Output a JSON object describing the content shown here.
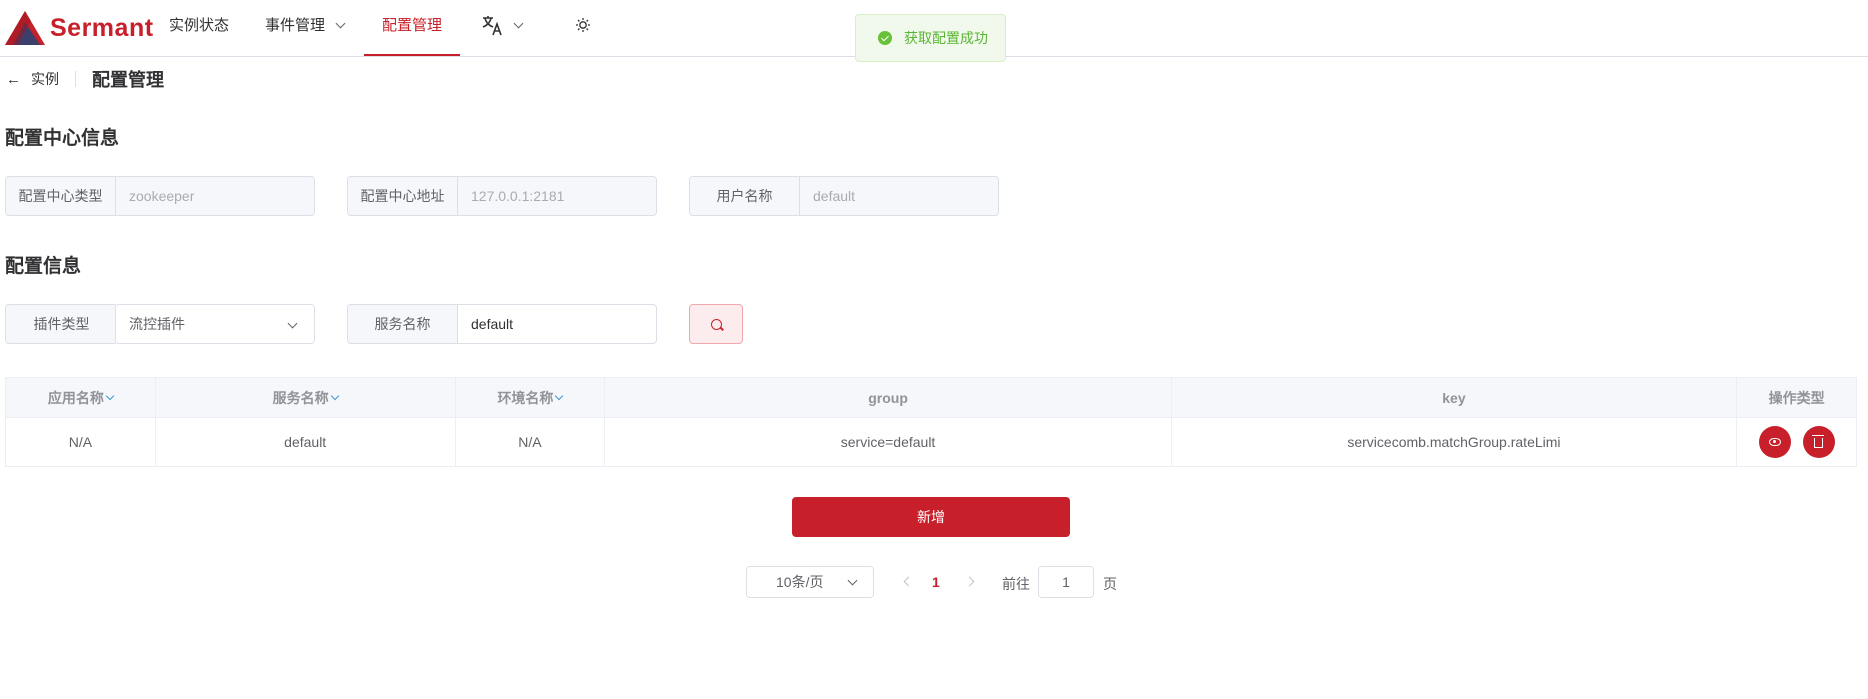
{
  "header": {
    "logo_text": "Sermant",
    "nav": [
      {
        "label": "实例状态"
      },
      {
        "label": "事件管理"
      },
      {
        "label": "配置管理"
      }
    ],
    "icons": [
      "translate-icon",
      "sun-icon"
    ]
  },
  "toast": {
    "message": "获取配置成功",
    "type": "success"
  },
  "breadcrumb": {
    "back_label": "实例",
    "title": "配置管理"
  },
  "config_center": {
    "section_title": "配置中心信息",
    "fields": [
      {
        "label": "配置中心类型",
        "value": "zookeeper"
      },
      {
        "label": "配置中心地址",
        "value": "127.0.0.1:2181"
      },
      {
        "label": "用户名称",
        "value": "default"
      }
    ]
  },
  "config_info": {
    "section_title": "配置信息",
    "plugin_type": {
      "label": "插件类型",
      "value": "流控插件"
    },
    "service_name": {
      "label": "服务名称",
      "value": "default"
    }
  },
  "table": {
    "columns": [
      "应用名称",
      "服务名称",
      "环境名称",
      "group",
      "key",
      "操作类型"
    ],
    "rows": [
      {
        "app": "N/A",
        "service": "default",
        "env": "N/A",
        "group": "service=default",
        "key": "servicecomb.matchGroup.rateLimi"
      }
    ]
  },
  "add_button": "新增",
  "pagination": {
    "page_size": "10条/页",
    "current_page": "1",
    "goto_label": "前往",
    "goto_value": "1",
    "page_unit": "页"
  },
  "colors": {
    "primary": "#c8202b",
    "success": "#67c23a"
  }
}
